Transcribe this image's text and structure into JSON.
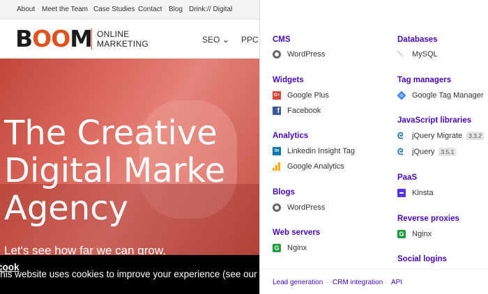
{
  "site": {
    "topnav": [
      "About",
      "Meet the Team",
      "Case Studies",
      "Contact",
      "Blog",
      "Drink:// Digital"
    ],
    "logo": {
      "b": "B",
      "oo": "OO",
      "m": "M",
      "sub_line1": "ONLINE",
      "sub_line2": "MARKETING"
    },
    "mainnav": {
      "seo": "SEO",
      "seo_caret": "⌄",
      "ppc": "PPC"
    },
    "hero_title": [
      "The Creative",
      "Digital Marke",
      "Agency"
    ],
    "hero_sub": "Let's see how far we can grow.",
    "cookie_text": "This website uses cookies to improve your experience (see our ",
    "cookie_link": "cook"
  },
  "panel": {
    "categories": {
      "cms": "CMS",
      "widgets": "Widgets",
      "analytics": "Analytics",
      "blogs": "Blogs",
      "web_servers": "Web servers",
      "databases": "Databases",
      "tag_managers": "Tag managers",
      "js_libraries": "JavaScript libraries",
      "paas": "PaaS",
      "reverse_proxies": "Reverse proxies",
      "social_logins": "Social logins"
    },
    "items": {
      "cms_wordpress": "WordPress",
      "google_plus": "Google Plus",
      "facebook": "Facebook",
      "linkedin": "Linkedin Insight Tag",
      "google_analytics": "Google Analytics",
      "blogs_wordpress": "WordPress",
      "nginx_web": "Nginx",
      "mysql": "MySQL",
      "gtm": "Google Tag Manager",
      "jquery_migrate": "jQuery Migrate",
      "jquery_migrate_ver": "3.3.2",
      "jquery": "jQuery",
      "jquery_ver": "3.5.1",
      "kinsta": "Kinsta",
      "nginx_proxy": "Nginx"
    },
    "footer": {
      "lead": "Lead generation",
      "sep": "·",
      "crm": "CRM integration",
      "api": "API"
    }
  },
  "colors": {
    "accent_purple": "#4708b5",
    "brand_orange": "#e0531d",
    "hero_red": "#c2473a"
  },
  "icons": [
    "wordpress-icon",
    "google-plus-icon",
    "facebook-icon",
    "linkedin-icon",
    "google-analytics-icon",
    "nginx-icon",
    "mysql-icon",
    "google-tag-manager-icon",
    "jquery-icon",
    "kinsta-icon"
  ]
}
